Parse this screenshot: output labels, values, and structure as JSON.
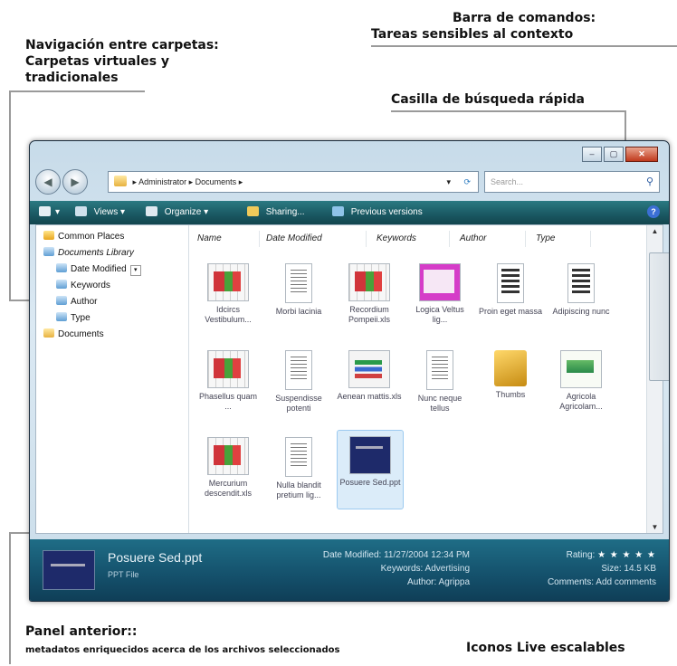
{
  "callouts": {
    "command_bar_1": "Barra de comandos:",
    "command_bar_2": "Tareas sensibles al contexto",
    "nav_1": "Navigación entre carpetas:",
    "nav_2": "Carpetas virtuales y",
    "nav_3": "tradicionales",
    "search": "Casilla de búsqueda rápida",
    "preview_1": "Panel anterior::",
    "preview_2": "metadatos enriquecidos acerca de los archivos seleccionados",
    "icons": "Iconos Live escalables"
  },
  "window": {
    "breadcrumb": [
      "Administrator",
      "Documents"
    ],
    "search_placeholder": "Search...",
    "back_icon": "back-arrow-icon",
    "forward_icon": "forward-arrow-icon"
  },
  "toolbar": {
    "views_label": "Views",
    "organize_label": "Organize",
    "sharing_label": "Sharing...",
    "previous_versions_label": "Previous versions"
  },
  "navigation": {
    "items": [
      "Common Places",
      "Documents Library",
      "Date Modified",
      "Keywords",
      "Author",
      "Type",
      "Documents"
    ]
  },
  "columns": [
    "Name",
    "Date Modified",
    "Keywords",
    "Author",
    "Type"
  ],
  "files": [
    {
      "name": "Idcircs Vestibulum...",
      "kind": "xls"
    },
    {
      "name": "Morbi lacinia",
      "kind": "doc"
    },
    {
      "name": "Recordium Pompeii.xls",
      "kind": "xls"
    },
    {
      "name": "Logica Veltus lig...",
      "kind": "pink"
    },
    {
      "name": "Proin eget massa",
      "kind": "dark"
    },
    {
      "name": "Adipiscing nunc",
      "kind": "dark"
    },
    {
      "name": "Phasellus quam ...",
      "kind": "xls"
    },
    {
      "name": "Suspendisse potenti",
      "kind": "doc"
    },
    {
      "name": "Aenean mattis.xls",
      "kind": "chart"
    },
    {
      "name": "Nunc neque tellus",
      "kind": "doc"
    },
    {
      "name": "Thumbs",
      "kind": "folder"
    },
    {
      "name": "Agricola Agricolam...",
      "kind": "green"
    },
    {
      "name": "Mercurium descendit.xls",
      "kind": "xls"
    },
    {
      "name": "Nulla blandit pretium lig...",
      "kind": "doc"
    },
    {
      "name": "Posuere Sed.ppt",
      "kind": "ppt",
      "selected": true
    }
  ],
  "details": {
    "file_name": "Posuere Sed.ppt",
    "file_type": "PPT File",
    "date_modified_label": "Date Modified:",
    "date_modified_value": "11/27/2004 12:34 PM",
    "keywords_label": "Keywords:",
    "keywords_value": "Advertising",
    "author_label": "Author:",
    "author_value": "Agrippa",
    "rating_label": "Rating:",
    "rating_stars": "★ ★ ★ ★ ★",
    "size_label": "Size:",
    "size_value": "14.5 KB",
    "comments_label": "Comments:",
    "comments_value": "Add comments"
  }
}
